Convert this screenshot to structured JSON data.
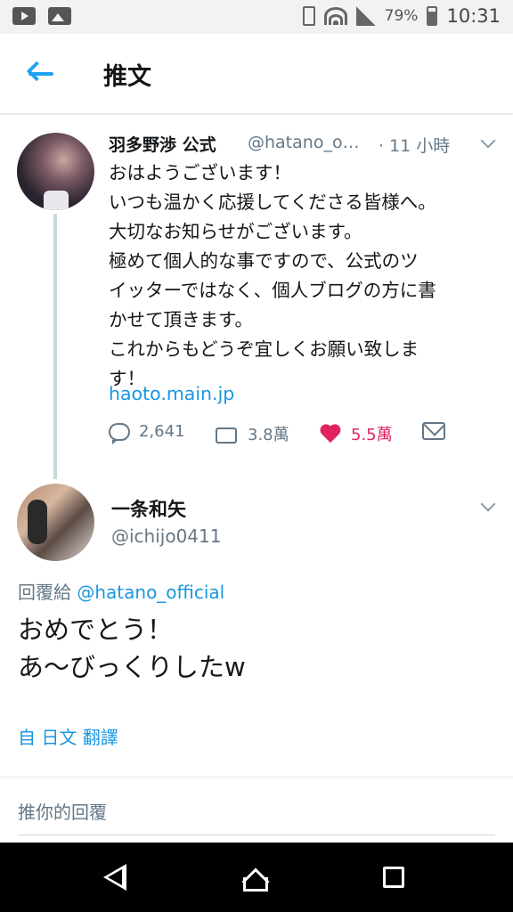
{
  "status_bar": {
    "battery_percent": "79%",
    "time": "10:31",
    "left_icons": [
      "youtube-icon",
      "image-icon"
    ],
    "right_icons": [
      "vibrate-icon",
      "wifi-icon",
      "signal-icon",
      "battery-icon"
    ]
  },
  "header": {
    "title": "推文",
    "back_icon": "arrow-left-icon"
  },
  "tweet": {
    "author_name": "羽多野渉 公式",
    "author_handle": "@hatano_o…",
    "time": "· 11 小時",
    "lines": [
      "おはようございます！",
      "いつも温かく応援してくださる皆様へ。",
      "大切なお知らせがございます。",
      "極めて個人的な事ですので、公式のツ",
      "イッターではなく、個人ブログの方に書",
      "かせて頂きます。",
      "これからもどうぞ宜しくお願い致しま",
      "す！"
    ],
    "link": "haoto.main.jp",
    "reply_count": "2,641",
    "retweet_count": "3.8萬",
    "like_count": "5.5萬"
  },
  "reply": {
    "author_name": "一条和矢",
    "author_handle": "@ichijo0411",
    "replying_prefix": "回覆給",
    "replying_to": "@hatano_official",
    "lines": [
      "おめでとう！",
      "あ〜びっくりしたw"
    ],
    "translate_label": "自 日文 翻譯"
  },
  "composer": {
    "placeholder": "推你的回覆"
  },
  "colors": {
    "accent": "#1da1f2",
    "link": "#1b95e0",
    "like": "#e0245e",
    "secondary_text": "#657786"
  }
}
